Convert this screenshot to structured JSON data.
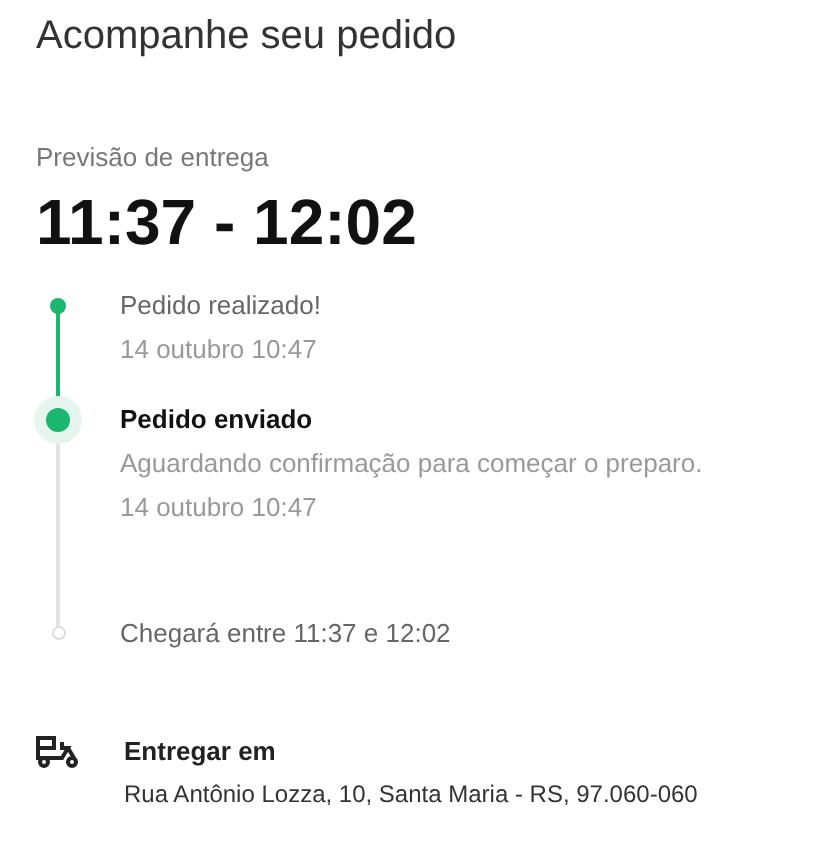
{
  "title": "Acompanhe seu pedido",
  "forecast": {
    "label": "Previsão de entrega",
    "time": "11:37 - 12:02"
  },
  "steps": [
    {
      "kind": "done",
      "title": "Pedido realizado!",
      "lines": [
        "14 outubro 10:47"
      ]
    },
    {
      "kind": "current",
      "title": "Pedido enviado",
      "lines": [
        "Aguardando confirmação para começar o preparo.",
        "14 outubro 10:47"
      ]
    },
    {
      "kind": "pending",
      "title": "Chegará entre 11:37 e 12:02"
    }
  ],
  "delivery": {
    "label": "Entregar em",
    "address": "Rua Antônio Lozza, 10, Santa Maria - RS, 97.060-060"
  }
}
